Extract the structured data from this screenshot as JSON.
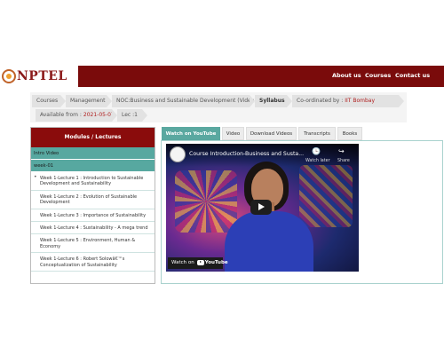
{
  "header": {
    "logo_text": "NPTEL",
    "nav": [
      "About us",
      "Courses",
      "Contact us"
    ]
  },
  "breadcrumb": {
    "items": [
      "Courses",
      "Management",
      "NOC:Business and Sustainable Development (Video)",
      "Syllabus"
    ],
    "coordinated_label": "Co-ordinated by :",
    "coordinated_value": "IIT Bombay",
    "available_label": "Available from :",
    "available_value": "2021-05-07",
    "lec_label": "Lec :",
    "lec_value": "1"
  },
  "sidebar": {
    "heading": "Modules / Lectures",
    "intro": "Intro Video",
    "week": "week-01",
    "lectures": [
      "Week 1-Lecture 1 : Introduction to Sustainable Development and Sustainability",
      "Week 1-Lecture 2 : Evolution of Sustainable Development",
      "Week 1-Lecture 3 : Importance of Sustainability",
      "Week 1-Lecture 4 : Sustainability - A mega trend",
      "Week 1-Lecture 5 : Environment, Human & Economy",
      "Week 1-Lecture 6 : Robert Solowâ€™s Conceptualization of Sustainability"
    ]
  },
  "tabs": [
    "Watch on YouTube",
    "Video",
    "Download Videos",
    "Transcripts",
    "Books"
  ],
  "video": {
    "title": "Course Introduction-Business and Susta...",
    "watch_later": "Watch later",
    "share": "Share",
    "watch_on": "Watch on",
    "youtube": "YouTube"
  },
  "colors": {
    "brand": "#7a0b0b",
    "accent": "#5aa8a0"
  }
}
